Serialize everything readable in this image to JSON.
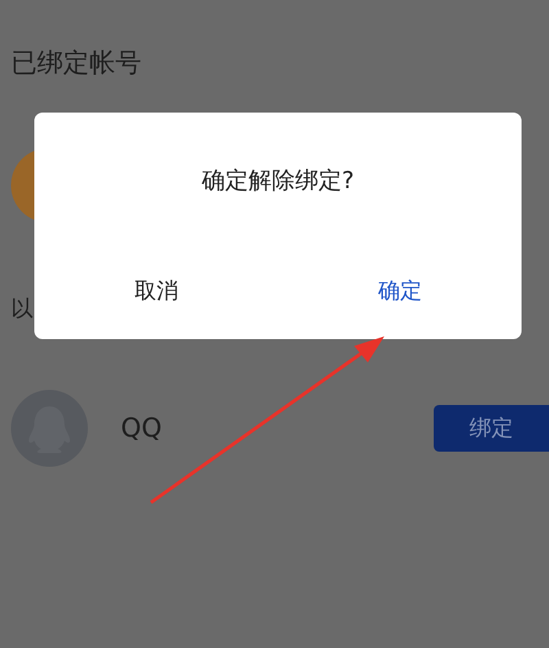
{
  "page": {
    "title": "已绑定帐号",
    "section_title": "以",
    "accounts": [
      {
        "name": "QQ",
        "action": "绑定"
      }
    ]
  },
  "dialog": {
    "message": "确定解除绑定?",
    "buttons": [
      {
        "label": "取消",
        "kind": "cancel"
      },
      {
        "label": "确定",
        "kind": "confirm"
      }
    ]
  }
}
